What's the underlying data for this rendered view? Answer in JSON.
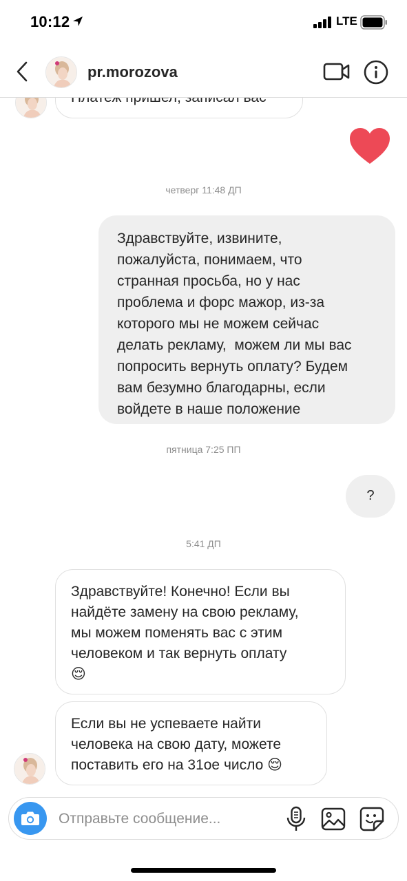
{
  "status_bar": {
    "time": "10:12",
    "network": "LTE"
  },
  "header": {
    "username": "pr.morozova",
    "icons": {
      "back": "chevron-left-icon",
      "video": "video-camera-icon",
      "info": "info-icon"
    }
  },
  "messages": {
    "partial_incoming": "Платеж пришел, записал вас",
    "reaction_icon": "heart-icon",
    "timestamp_1": "четверг 11:48 ДП",
    "outgoing_1": {
      "lines": [
        "Здравствуйте, извините,",
        "пожалуйста, понимаем, что",
        "странная просьба, но у нас",
        "проблема и форс мажор, из-за",
        "которого мы не можем сейчас",
        "делать рекламу,  можем ли мы вас",
        "попросить вернуть оплату? Будем",
        "вам безумно благодарны, если",
        "войдете в наше положение"
      ]
    },
    "timestamp_2": "пятница 7:25 ПП",
    "outgoing_2": "?",
    "timestamp_3": "5:41 ДП",
    "incoming_1": {
      "lines": [
        "Здравствуйте! Конечно! Если вы",
        "найдёте замену на свою рекламу,",
        "мы можем поменять вас с этим",
        "человеком и так вернуть оплату",
        "😌"
      ]
    },
    "incoming_2": {
      "lines": [
        "Если вы не успеваете найти",
        "человека на свою дату, можете",
        "поставить его на 31ое число 😌"
      ]
    }
  },
  "composer": {
    "placeholder": "Отправьте сообщение...",
    "icons": {
      "camera": "camera-icon",
      "mic": "microphone-icon",
      "gallery": "gallery-icon",
      "sticker": "sticker-icon"
    }
  },
  "colors": {
    "accent": "#3897f0",
    "heart": "#ed4956",
    "outgoing_bubble": "#efefef"
  }
}
